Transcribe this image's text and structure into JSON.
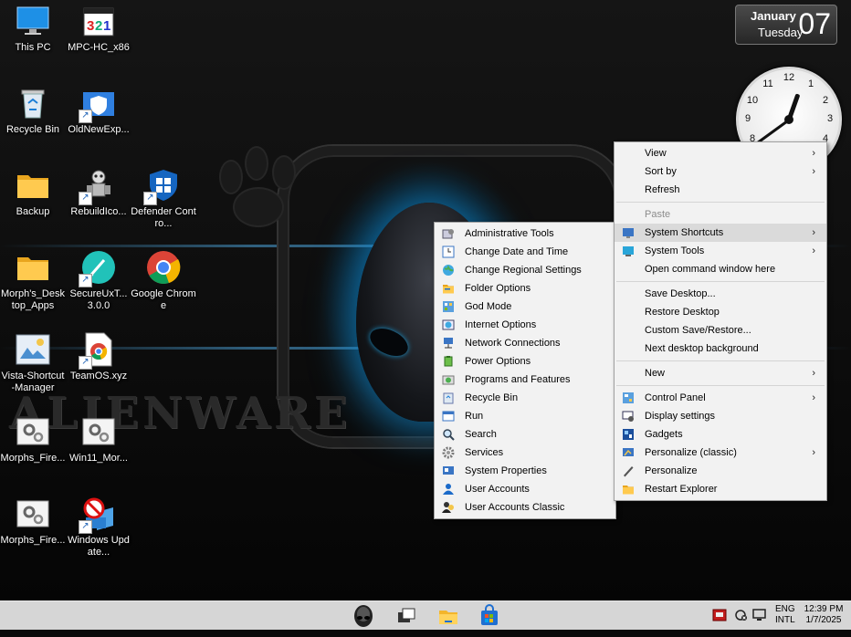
{
  "calendar": {
    "month": "January",
    "weekday": "Tuesday",
    "day": "07"
  },
  "clock": {
    "numbers": [
      "12",
      "1",
      "2",
      "3",
      "4",
      "8",
      "9",
      "10",
      "11"
    ],
    "hour": 12,
    "minute": 39
  },
  "wallpaper": {
    "brand": "ALIENWARE"
  },
  "desktop_icons": [
    {
      "label": "This PC",
      "icon": "monitor-icon"
    },
    {
      "label": "MPC-HC_x86",
      "icon": "mpc-hc-icon"
    },
    {
      "label": "Recycle Bin",
      "icon": "recycle-bin-icon"
    },
    {
      "label": "OldNewExp...",
      "icon": "shield-folder-icon"
    },
    {
      "label": "Backup",
      "icon": "folder-icon"
    },
    {
      "label": "RebuildIco...",
      "icon": "robot-icon"
    },
    {
      "label": "Defender Contro...",
      "icon": "defender-icon"
    },
    {
      "label": "Morph's_Desktop_Apps",
      "icon": "folder-icon"
    },
    {
      "label": "SecureUxT... 3.0.0",
      "icon": "brush-icon"
    },
    {
      "label": "Google Chrome",
      "icon": "chrome-icon"
    },
    {
      "label": "Vista-Shortcut-Manager",
      "icon": "shortcut-manager-icon"
    },
    {
      "label": "TeamOS.xyz",
      "icon": "chrome-doc-icon"
    },
    {
      "label": "Morphs_Fire...",
      "icon": "gear-window-icon"
    },
    {
      "label": "Win11_Mor...",
      "icon": "gear-window-icon"
    },
    {
      "label": "Morphs_Fire...",
      "icon": "gear-window-icon"
    },
    {
      "label": "Windows Update...",
      "icon": "update-blocked-icon"
    }
  ],
  "main_menu": {
    "items": [
      {
        "label": "View",
        "submenu": true
      },
      {
        "label": "Sort by",
        "submenu": true
      },
      {
        "label": "Refresh"
      },
      {
        "sep": true
      },
      {
        "label": "Paste",
        "disabled": true
      },
      {
        "label": "System Shortcuts",
        "submenu": true,
        "highlighted": true,
        "icon": "system-shortcuts-icon"
      },
      {
        "label": "System Tools",
        "submenu": true,
        "icon": "system-tools-icon"
      },
      {
        "label": "Open command window here"
      },
      {
        "sep": true
      },
      {
        "label": "Save Desktop..."
      },
      {
        "label": "Restore Desktop"
      },
      {
        "label": "Custom Save/Restore..."
      },
      {
        "label": "Next desktop background"
      },
      {
        "sep": true
      },
      {
        "label": "New",
        "submenu": true
      },
      {
        "sep": true
      },
      {
        "label": "Control Panel",
        "submenu": true,
        "icon": "control-panel-icon"
      },
      {
        "label": "Display settings",
        "icon": "display-settings-icon"
      },
      {
        "label": "Gadgets",
        "icon": "gadgets-icon"
      },
      {
        "label": "Personalize (classic)",
        "submenu": true,
        "icon": "personalize-classic-icon"
      },
      {
        "label": "Personalize",
        "icon": "pen-icon"
      },
      {
        "label": "Restart Explorer",
        "icon": "folder-icon"
      }
    ]
  },
  "sub_menu": {
    "items": [
      {
        "label": "Administrative Tools",
        "icon": "admin-tools-icon"
      },
      {
        "label": "Change Date and Time",
        "icon": "date-time-icon"
      },
      {
        "label": "Change Regional Settings",
        "icon": "globe-icon"
      },
      {
        "label": "Folder Options",
        "icon": "folder-options-icon"
      },
      {
        "label": "God Mode",
        "icon": "god-mode-icon"
      },
      {
        "label": "Internet Options",
        "icon": "internet-options-icon"
      },
      {
        "label": "Network Connections",
        "icon": "network-icon"
      },
      {
        "label": "Power Options",
        "icon": "power-icon"
      },
      {
        "label": "Programs and Features",
        "icon": "programs-icon"
      },
      {
        "label": "Recycle Bin",
        "icon": "recycle-bin-icon"
      },
      {
        "label": "Run",
        "icon": "run-icon"
      },
      {
        "label": "Search",
        "icon": "search-icon"
      },
      {
        "label": "Services",
        "icon": "services-icon"
      },
      {
        "label": "System Properties",
        "icon": "system-properties-icon"
      },
      {
        "label": "User Accounts",
        "icon": "user-icon"
      },
      {
        "label": "User Accounts Classic",
        "icon": "user-classic-icon"
      }
    ]
  },
  "taskbar": {
    "apps": [
      "alien-start-icon",
      "task-view-icon",
      "file-explorer-icon",
      "store-icon"
    ],
    "lang_top": "ENG",
    "lang_bottom": "INTL",
    "time": "12:39 PM",
    "date": "1/7/2025"
  }
}
